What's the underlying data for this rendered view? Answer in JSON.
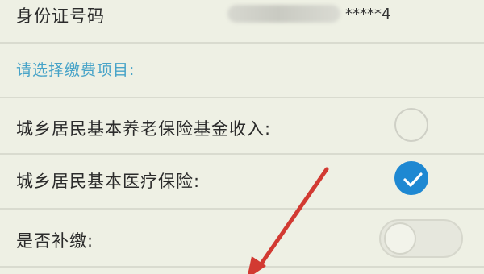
{
  "form": {
    "id_label": "身份证号码",
    "id_value": "*****4",
    "section_title": "请选择缴费项目:",
    "items": [
      {
        "label": "城乡居民基本养老保险基金收入:",
        "selected": false
      },
      {
        "label": "城乡居民基本医疗保险:",
        "selected": true
      }
    ],
    "backpay_label": "是否补缴:",
    "backpay_enabled": false
  },
  "colors": {
    "accent": "#1e88d2",
    "section_title": "#47a3c8",
    "annotation_arrow": "#d23a32"
  }
}
